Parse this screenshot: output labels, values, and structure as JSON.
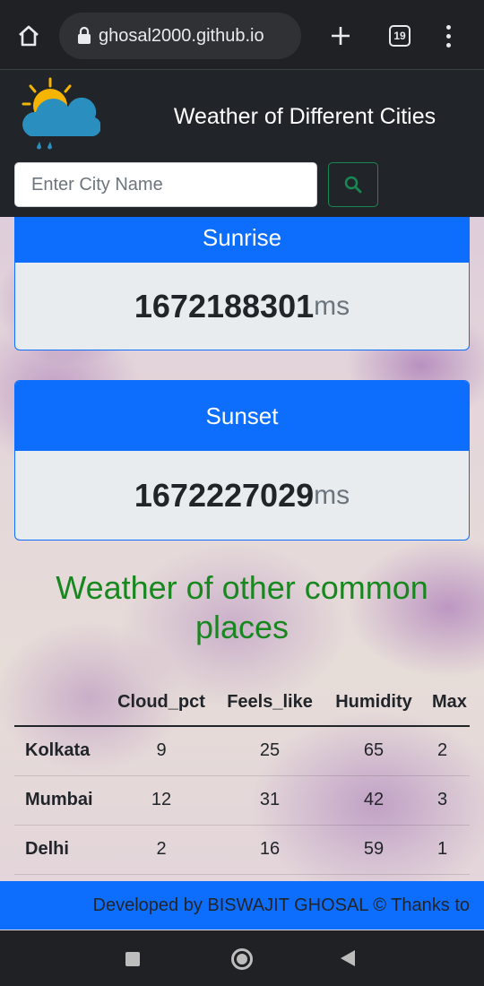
{
  "browser": {
    "url": "ghosal2000.github.io",
    "tab_count": "19"
  },
  "header": {
    "title": "Weather of Different Cities",
    "search_placeholder": "Enter City Name",
    "logo_icon": "sun-cloud-rain-icon",
    "search_icon": "search-icon"
  },
  "sunrise": {
    "label": "Sunrise",
    "value": "1672188301",
    "unit": "ms"
  },
  "sunset": {
    "label": "Sunset",
    "value": "1672227029",
    "unit": "ms"
  },
  "section_title": "Weather of other common places",
  "table": {
    "headers": [
      "",
      "Cloud_pct",
      "Feels_like",
      "Humidity",
      "Max"
    ],
    "rows": [
      {
        "city": "Kolkata",
        "cloud_pct": "9",
        "feels_like": "25",
        "humidity": "65",
        "max": "2"
      },
      {
        "city": "Mumbai",
        "cloud_pct": "12",
        "feels_like": "31",
        "humidity": "42",
        "max": "3"
      },
      {
        "city": "Delhi",
        "cloud_pct": "2",
        "feels_like": "16",
        "humidity": "59",
        "max": "1"
      }
    ]
  },
  "footer": {
    "text": "Developed by BISWAJIT GHOSAL © Thanks to"
  },
  "colors": {
    "primary": "#0d6efd",
    "success": "#198754",
    "dark": "#212529",
    "title_green": "#198720"
  }
}
